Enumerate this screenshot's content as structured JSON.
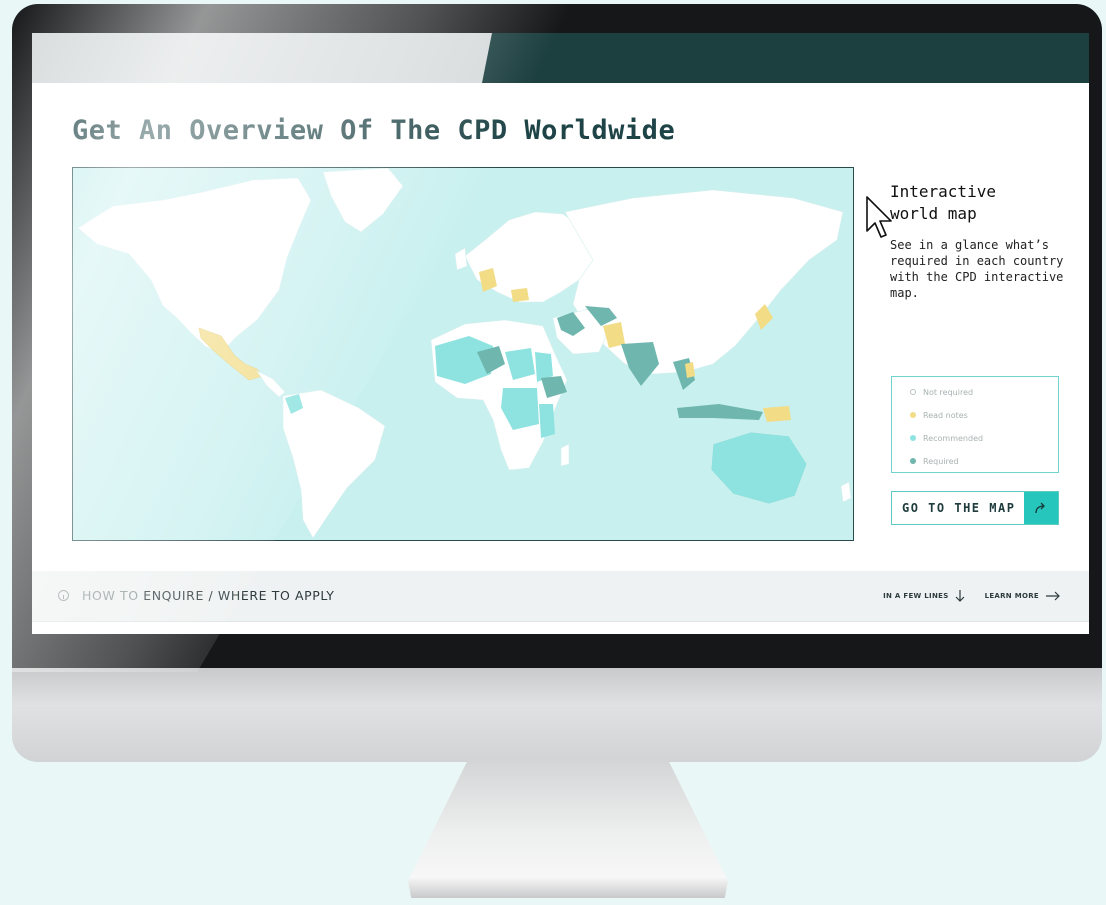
{
  "page": {
    "title": "Get An Overview Of The CPD Worldwide"
  },
  "side": {
    "title_line1": "Interactive",
    "title_line2": "world map",
    "description": "See in a glance what’s required in each country with the CPD interactive map."
  },
  "legend": [
    {
      "label": "Not required",
      "color": "#ffffff"
    },
    {
      "label": "Read notes",
      "color": "#f2dc85"
    },
    {
      "label": "Recommended",
      "color": "#8ee3e0"
    },
    {
      "label": "Required",
      "color": "#6fb7ae"
    }
  ],
  "go_button": {
    "label": "GO TO THE MAP",
    "icon": "redirect-arrow-icon"
  },
  "info_bar": {
    "icon": "info-icon",
    "prefix": "HOW TO",
    "text": "ENQUIRE / WHERE TO APPLY",
    "link_lines": "IN A FEW LINES",
    "link_more": "LEARN MORE"
  },
  "colors": {
    "ocean": "#c8f0ef",
    "not_required": "#ffffff",
    "read_notes": "#f2dc85",
    "recommended": "#8ee3e0",
    "required": "#6fb7ae",
    "accent": "#27c6bd",
    "header": "#1c3f40"
  }
}
